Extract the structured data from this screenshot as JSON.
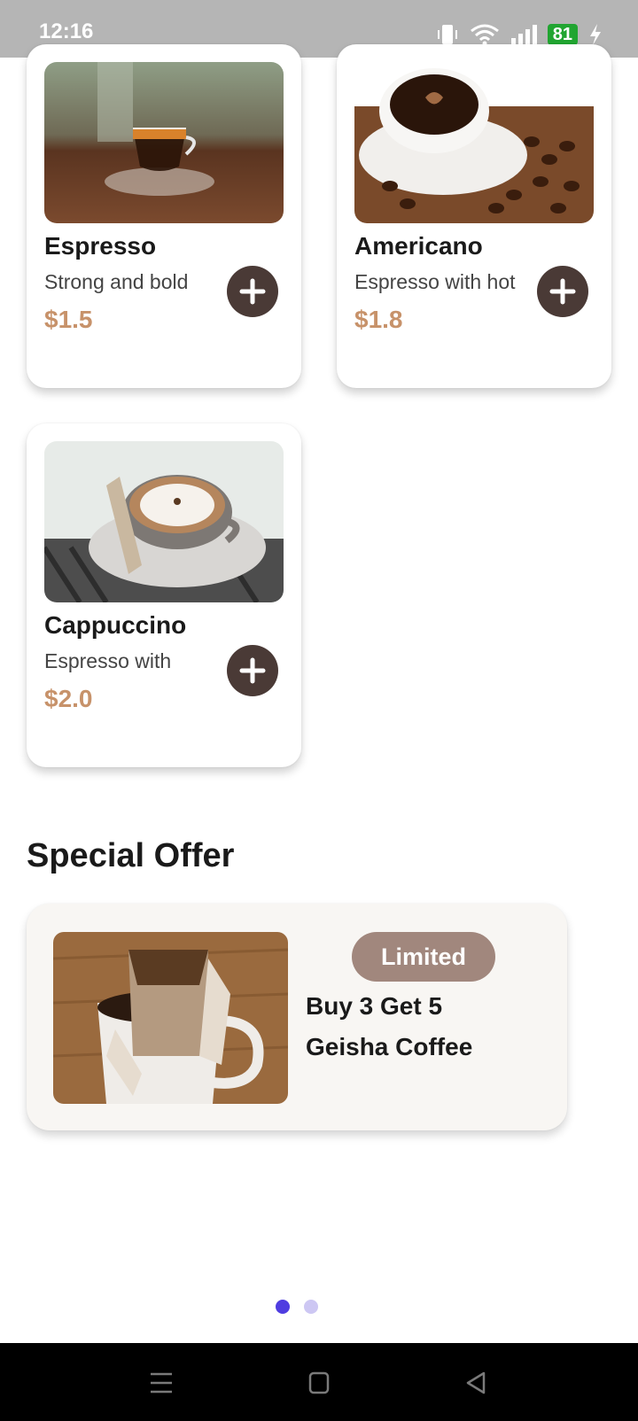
{
  "status_bar": {
    "time": "12:16",
    "battery": "81",
    "icons": [
      "vibrate-icon",
      "wifi-icon",
      "signal-icon",
      "battery-icon",
      "charging-icon"
    ]
  },
  "products": [
    {
      "name": "Espresso",
      "description": "Strong and bold",
      "price": "$1.5",
      "image": "espresso-photo"
    },
    {
      "name": "Americano",
      "description": "Espresso with hot",
      "price": "$1.8",
      "image": "americano-photo"
    },
    {
      "name": "Cappuccino",
      "description": "Espresso with",
      "price": "$2.0",
      "image": "cappuccino-photo"
    }
  ],
  "special_offer": {
    "title": "Special Offer",
    "badge": "Limited",
    "line1": "Buy 3 Get 5",
    "line2": "Geisha Coffee",
    "image": "drip-coffee-photo"
  },
  "pager": {
    "page_count": 2,
    "current_page": 1
  },
  "colors": {
    "accent_price": "#c7926a",
    "button_dark": "#4a3a36",
    "badge": "#a1877d",
    "dot_active": "#4f3de0",
    "dot_inactive": "#cdc7f3"
  },
  "nav_bar": {
    "icons": [
      "menu-icon",
      "home-icon",
      "back-icon"
    ]
  }
}
